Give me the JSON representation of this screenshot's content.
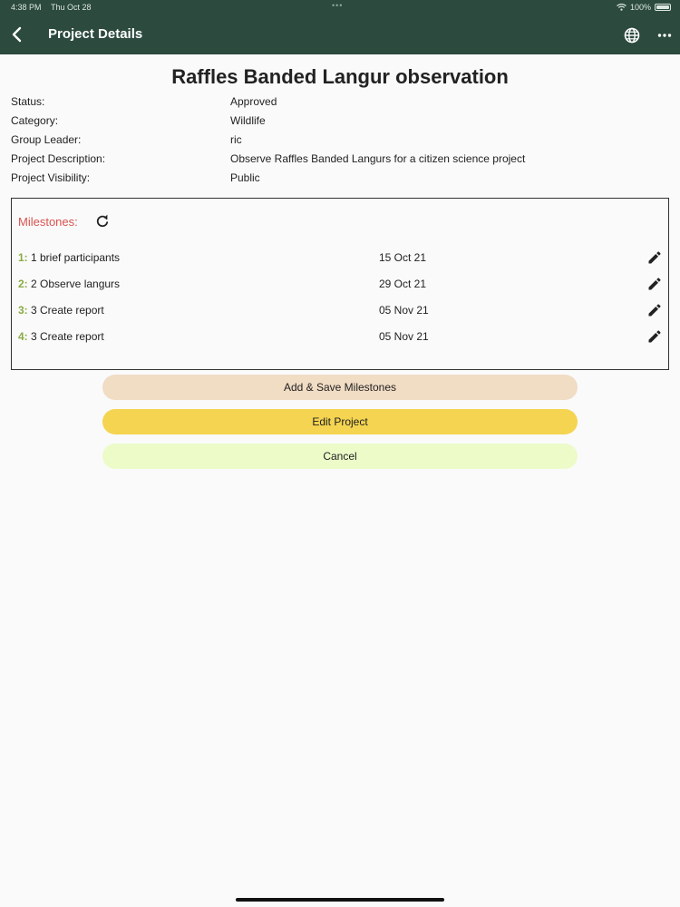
{
  "status_bar": {
    "time": "4:38 PM",
    "date": "Thu Oct 28",
    "dots": "•••",
    "battery": "100%"
  },
  "header": {
    "title": "Project Details",
    "back_icon": "chevron-left-icon",
    "globe_icon": "globe-icon",
    "more_icon": "more-icon"
  },
  "project": {
    "heading": "Raffles Banded Langur observation",
    "fields": [
      {
        "label": "Status:",
        "value": "Approved"
      },
      {
        "label": "Category:",
        "value": "Wildlife"
      },
      {
        "label": "Group Leader:",
        "value": "ric"
      },
      {
        "label": "Project Description:",
        "value": "Observe Raffles Banded Langurs for a citizen science project"
      },
      {
        "label": "Project Visibility:",
        "value": "Public"
      }
    ]
  },
  "milestones": {
    "title": "Milestones:",
    "refresh_icon": "refresh-icon",
    "items": [
      {
        "num": "1:",
        "name": "1 brief participants",
        "date": "15 Oct 21"
      },
      {
        "num": "2:",
        "name": "2 Observe langurs",
        "date": "29 Oct 21"
      },
      {
        "num": "3:",
        "name": "3 Create report",
        "date": "05 Nov 21"
      },
      {
        "num": "4:",
        "name": "3 Create report",
        "date": "05 Nov 21"
      }
    ]
  },
  "buttons": {
    "add_save": "Add & Save Milestones",
    "edit": "Edit Project",
    "cancel": "Cancel"
  },
  "colors": {
    "header_bg": "#2c4a3e",
    "milestone_title": "#d9534f",
    "milestone_num": "#8bab45",
    "add_btn": "#f1dcc4",
    "edit_btn": "#f4d450",
    "cancel_btn": "#ecfbc8"
  }
}
